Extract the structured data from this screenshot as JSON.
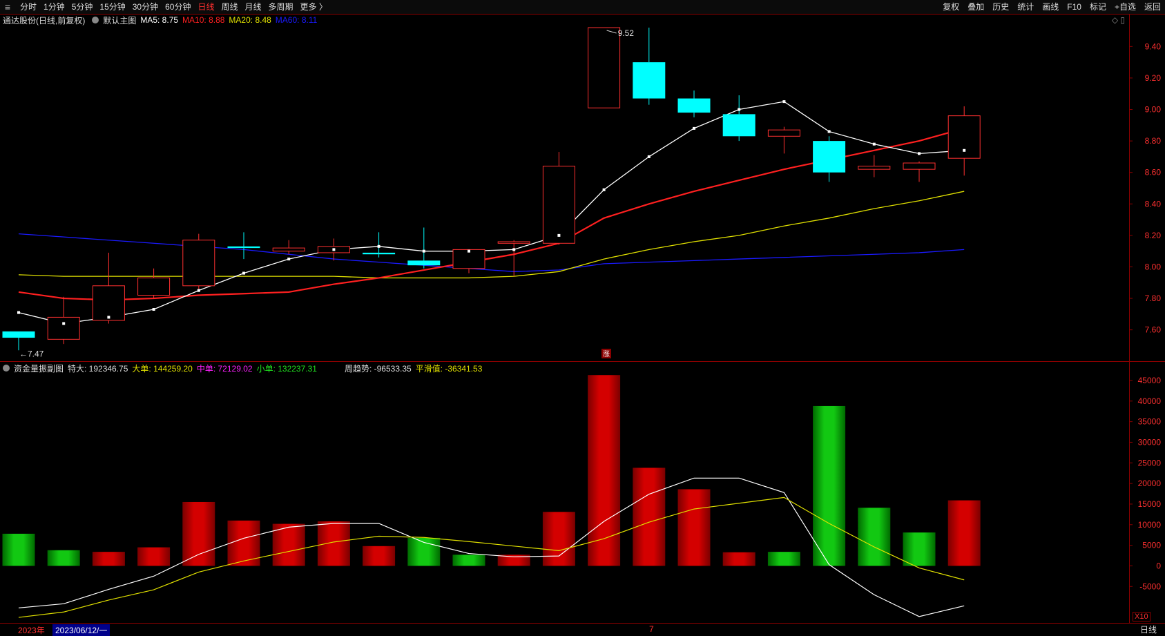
{
  "toolbar": {
    "menu_icon": "hamburger-menu-icon",
    "periods": [
      "分时",
      "1分钟",
      "5分钟",
      "15分钟",
      "30分钟",
      "60分钟",
      "日线",
      "周线",
      "月线",
      "多周期",
      "更多 〉"
    ],
    "active_period": "日线",
    "right_items": [
      "复权",
      "叠加",
      "历史",
      "统计",
      "画线",
      "F10",
      "标记",
      "+自选",
      "返回"
    ]
  },
  "main_info": {
    "stock": "通达股份(日线,前复权)",
    "template": "默认主图",
    "ma5": "MA5: 8.75",
    "ma10": "MA10: 8.88",
    "ma20": "MA20: 8.48",
    "ma60": "MA60: 8.11",
    "colors": {
      "ma5": "#ffffff",
      "ma10": "#ff2020",
      "ma20": "#e0e000",
      "ma60": "#1a1aff",
      "up": "#ff3030",
      "down": "#00ffff"
    }
  },
  "sub_info": {
    "name": "资金量振副图",
    "tedal": "特大: 192346.75",
    "dadan": "大单: 144259.20",
    "zhongdan": "中单: 72129.02",
    "xiaodan": "小单: 132237.31",
    "zhouqushi": "周趋势: -96533.35",
    "pinghua": "平滑值: -36341.53"
  },
  "footer": {
    "year": "2023年",
    "selected_date": "2023/06/12/一",
    "month_mark": "7",
    "period": "日线",
    "x10": "X10",
    "zhang_mark": "涨"
  },
  "chart_data": [
    {
      "type": "candlestick",
      "title": "通达股份(日线,前复权)",
      "y_ticks": [
        "9.40",
        "9.20",
        "9.00",
        "8.80",
        "8.60",
        "8.40",
        "8.20",
        "8.00",
        "7.80",
        "7.60"
      ],
      "ylim": [
        7.48,
        9.52
      ],
      "annotations": {
        "high_label": "9.52",
        "low_label": "7.47"
      },
      "candles": [
        {
          "o": 7.59,
          "c": 7.55,
          "h": 7.59,
          "l": 7.47
        },
        {
          "o": 7.54,
          "c": 7.68,
          "h": 7.81,
          "l": 7.51
        },
        {
          "o": 7.66,
          "c": 7.88,
          "h": 8.09,
          "l": 7.64
        },
        {
          "o": 7.82,
          "c": 7.93,
          "h": 7.99,
          "l": 7.8
        },
        {
          "o": 7.88,
          "c": 8.17,
          "h": 8.21,
          "l": 7.86
        },
        {
          "o": 8.13,
          "c": 8.12,
          "h": 8.22,
          "l": 8.05
        },
        {
          "o": 8.1,
          "c": 8.12,
          "h": 8.17,
          "l": 8.08
        },
        {
          "o": 8.09,
          "c": 8.13,
          "h": 8.18,
          "l": 8.04
        },
        {
          "o": 8.09,
          "c": 8.08,
          "h": 8.22,
          "l": 8.06
        },
        {
          "o": 8.04,
          "c": 8.01,
          "h": 8.25,
          "l": 7.99
        },
        {
          "o": 7.99,
          "c": 8.11,
          "h": 8.11,
          "l": 7.96
        },
        {
          "o": 8.15,
          "c": 8.16,
          "h": 8.17,
          "l": 7.94
        },
        {
          "o": 8.15,
          "c": 8.64,
          "h": 8.73,
          "l": 8.14
        },
        {
          "o": 9.01,
          "c": 9.52,
          "h": 9.52,
          "l": 9.01
        },
        {
          "o": 9.3,
          "c": 9.07,
          "h": 9.52,
          "l": 9.03
        },
        {
          "o": 9.07,
          "c": 8.98,
          "h": 9.12,
          "l": 8.95
        },
        {
          "o": 8.97,
          "c": 8.83,
          "h": 9.09,
          "l": 8.8
        },
        {
          "o": 8.83,
          "c": 8.87,
          "h": 8.89,
          "l": 8.72
        },
        {
          "o": 8.8,
          "c": 8.6,
          "h": 8.83,
          "l": 8.54
        },
        {
          "o": 8.62,
          "c": 8.64,
          "h": 8.71,
          "l": 8.57
        },
        {
          "o": 8.62,
          "c": 8.66,
          "h": 8.67,
          "l": 8.54
        },
        {
          "o": 8.69,
          "c": 8.96,
          "h": 9.02,
          "l": 8.58
        }
      ],
      "series": [
        {
          "name": "MA5",
          "values": [
            7.71,
            7.64,
            7.68,
            7.73,
            7.85,
            7.96,
            8.05,
            8.11,
            8.13,
            8.1,
            8.1,
            8.11,
            8.2,
            8.49,
            8.7,
            8.88,
            9.0,
            9.05,
            8.86,
            8.78,
            8.72,
            8.74
          ]
        },
        {
          "name": "MA10",
          "values": [
            7.84,
            7.8,
            7.79,
            7.8,
            7.82,
            7.83,
            7.84,
            7.89,
            7.93,
            7.98,
            8.03,
            8.08,
            8.15,
            8.31,
            8.4,
            8.48,
            8.55,
            8.62,
            8.68,
            8.74,
            8.8,
            8.88
          ]
        },
        {
          "name": "MA20",
          "values": [
            7.95,
            7.94,
            7.94,
            7.94,
            7.94,
            7.94,
            7.94,
            7.94,
            7.93,
            7.93,
            7.93,
            7.94,
            7.97,
            8.05,
            8.11,
            8.16,
            8.2,
            8.26,
            8.31,
            8.37,
            8.42,
            8.48
          ]
        },
        {
          "name": "MA60",
          "values": [
            8.21,
            8.19,
            8.17,
            8.15,
            8.13,
            8.11,
            8.08,
            8.05,
            8.03,
            8.01,
            7.99,
            7.97,
            7.98,
            8.02,
            8.03,
            8.04,
            8.05,
            8.06,
            8.07,
            8.08,
            8.09,
            8.11
          ]
        }
      ]
    },
    {
      "type": "bar",
      "title": "资金量振副图",
      "y_ticks": [
        "45000",
        "40000",
        "35000",
        "30000",
        "25000",
        "20000",
        "15000",
        "10000",
        "5000",
        "0",
        "-5000"
      ],
      "ylim": [
        -13500,
        46500
      ],
      "bars": [
        {
          "v": 7800,
          "color": "green"
        },
        {
          "v": 3800,
          "color": "green"
        },
        {
          "v": 3400,
          "color": "red"
        },
        {
          "v": 4500,
          "color": "red"
        },
        {
          "v": 15500,
          "color": "red"
        },
        {
          "v": 11000,
          "color": "red"
        },
        {
          "v": 10200,
          "color": "red"
        },
        {
          "v": 10800,
          "color": "red"
        },
        {
          "v": 4800,
          "color": "red"
        },
        {
          "v": 6800,
          "color": "green"
        },
        {
          "v": 2700,
          "color": "green"
        },
        {
          "v": 2700,
          "color": "red"
        },
        {
          "v": 13100,
          "color": "red"
        },
        {
          "v": 46300,
          "color": "red"
        },
        {
          "v": 23800,
          "color": "red"
        },
        {
          "v": 18600,
          "color": "red"
        },
        {
          "v": 3300,
          "color": "red"
        },
        {
          "v": 3400,
          "color": "green"
        },
        {
          "v": 38800,
          "color": "green"
        },
        {
          "v": 14100,
          "color": "green"
        },
        {
          "v": 8100,
          "color": "green"
        },
        {
          "v": 15900,
          "color": "red"
        }
      ],
      "series": [
        {
          "name": "周趋势",
          "values": [
            -10200,
            -9200,
            -5700,
            -2500,
            2800,
            6700,
            9400,
            10300,
            10300,
            5700,
            3000,
            2200,
            2400,
            10800,
            17400,
            21300,
            21300,
            17800,
            300,
            -7000,
            -12300,
            -9700
          ]
        },
        {
          "name": "平滑值",
          "values": [
            -12500,
            -11200,
            -8300,
            -5800,
            -1500,
            1200,
            3500,
            5800,
            7200,
            6900,
            5900,
            4800,
            3700,
            6600,
            10600,
            13800,
            15200,
            16600,
            10300,
            4600,
            -500,
            -3400
          ]
        }
      ]
    }
  ]
}
